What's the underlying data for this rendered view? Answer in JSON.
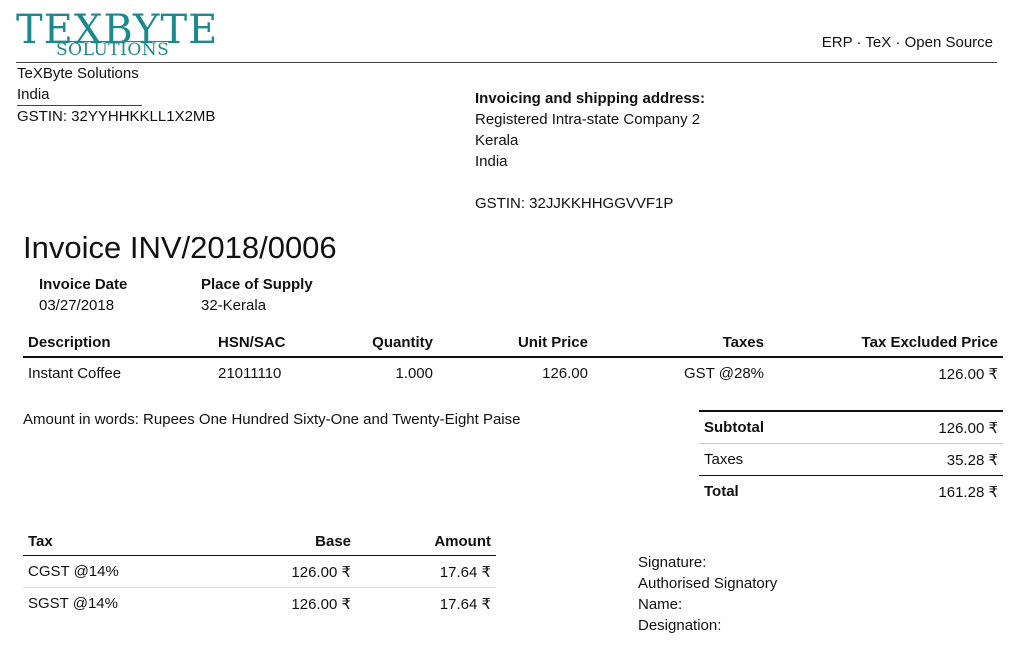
{
  "logo": {
    "main": "TEXBYTE",
    "sub": "SOLUTIONS"
  },
  "header": {
    "tagline": "ERP · TeX · Open Source"
  },
  "company": {
    "name": "TeXByte Solutions",
    "country": "India",
    "gstin": "GSTIN: 32YYHHKKLL1X2MB"
  },
  "address": {
    "heading": "Invoicing and shipping address:",
    "name": "Registered Intra-state Company 2",
    "state": "Kerala",
    "country": "India",
    "gstin": "GSTIN: 32JJKKHHGGVVF1P"
  },
  "invoice": {
    "title": "Invoice INV/2018/0006",
    "date_label": "Invoice Date",
    "date": "03/27/2018",
    "supply_label": "Place of Supply",
    "supply": "32-Kerala"
  },
  "lines": {
    "headers": [
      "Description",
      "HSN/SAC",
      "Quantity",
      "Unit Price",
      "Taxes",
      "Tax Excluded Price"
    ],
    "rows": [
      [
        "Instant Coffee",
        "21011110",
        "1.000",
        "126.00",
        "GST @28%",
        "126.00 ₹"
      ]
    ]
  },
  "amount_words": "Amount in words: Rupees One Hundred Sixty-One and Twenty-Eight Paise",
  "totals": {
    "subtotal_label": "Subtotal",
    "subtotal": "126.00 ₹",
    "taxes_label": "Taxes",
    "taxes": "35.28 ₹",
    "total_label": "Total",
    "total": "161.28 ₹"
  },
  "tax_table": {
    "headers": [
      "Tax",
      "Base",
      "Amount"
    ],
    "rows": [
      [
        "CGST @14%",
        "126.00 ₹",
        "17.64 ₹"
      ],
      [
        "SGST @14%",
        "126.00 ₹",
        "17.64 ₹"
      ]
    ]
  },
  "signature": {
    "label": "Signature:",
    "authority": "Authorised Signatory",
    "name": "Name:",
    "designation": "Designation:"
  },
  "colors": {
    "brand": "#1c8a8d"
  }
}
